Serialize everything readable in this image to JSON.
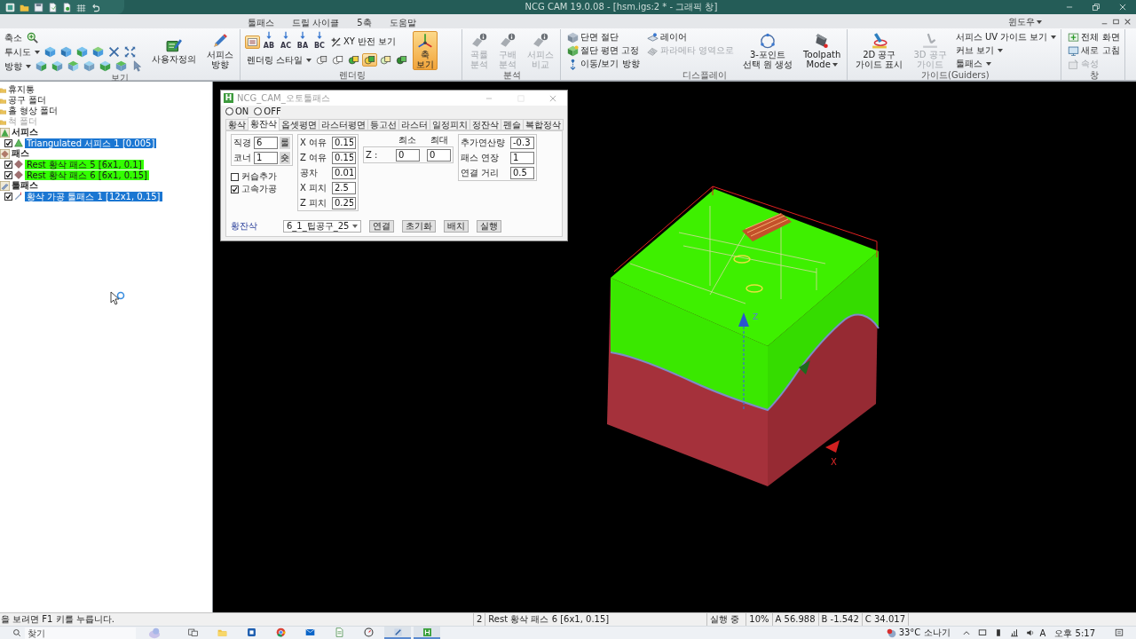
{
  "window": {
    "title": "NCG CAM 19.0.08 - [hsm.igs:2 * - 그래픽 창]"
  },
  "ribbon": {
    "tabs": [
      {
        "label": "툴패스",
        "selected": false
      },
      {
        "label": "드릴 사이클",
        "selected": false
      },
      {
        "label": "5축",
        "selected": false
      },
      {
        "label": "도움말",
        "selected": false
      }
    ],
    "window_menu": "윈도우",
    "groups": [
      {
        "title": "보기",
        "columns": [
          {
            "kind": "stack",
            "rows": [
              [
                {
                  "kind": "text",
                  "label": "축소",
                  "menu": false,
                  "disabled": false
                },
                {
                  "kind": "tool",
                  "on": false
                }
              ],
              [
                {
                  "kind": "text",
                  "label": "투시도",
                  "menu": true,
                  "disabled": false
                },
                {
                  "kind": "tool",
                  "on": false
                },
                {
                  "kind": "tool",
                  "on": false
                },
                {
                  "kind": "tool",
                  "on": false
                },
                {
                  "kind": "tool",
                  "on": false
                },
                {
                  "kind": "tool",
                  "on": false
                },
                {
                  "kind": "tool",
                  "on": false
                }
              ],
              [
                {
                  "kind": "text",
                  "label": "방향",
                  "menu": true,
                  "disabled": false
                },
                {
                  "kind": "tool",
                  "on": false
                },
                {
                  "kind": "tool",
                  "on": false
                },
                {
                  "kind": "tool",
                  "on": false
                },
                {
                  "kind": "tool",
                  "on": false
                },
                {
                  "kind": "tool",
                  "on": false
                },
                {
                  "kind": "tool",
                  "on": false
                },
                {
                  "kind": "tool",
                  "on": false
                }
              ]
            ]
          },
          {
            "kind": "large",
            "label": "사용자정의",
            "menu": false,
            "disabled": false,
            "on": false
          },
          {
            "kind": "large",
            "label": "서피스\n방향",
            "menu": false,
            "disabled": false,
            "on": false
          }
        ]
      },
      {
        "title": "렌더링",
        "columns": [
          {
            "kind": "stack",
            "rows": [
              [
                {
                  "kind": "tool",
                  "on": true
                },
                {
                  "kind": "caption",
                  "label": "AB"
                },
                {
                  "kind": "caption",
                  "label": "AC"
                },
                {
                  "kind": "caption",
                  "label": "BA"
                },
                {
                  "kind": "caption",
                  "label": "BC"
                },
                {
                  "kind": "text",
                  "label": "XY 반전 보기",
                  "menu": false,
                  "disabled": false
                }
              ],
              [
                {
                  "kind": "text",
                  "label": "렌더링 스타일",
                  "menu": true,
                  "disabled": false
                },
                {
                  "kind": "tool",
                  "on": false
                },
                {
                  "kind": "tool",
                  "on": false
                },
                {
                  "kind": "tool",
                  "on": false
                },
                {
                  "kind": "tool",
                  "on": true
                },
                {
                  "kind": "tool",
                  "on": false
                },
                {
                  "kind": "tool",
                  "on": false
                }
              ]
            ]
          },
          {
            "kind": "large",
            "label": "축\n보기",
            "menu": false,
            "disabled": false,
            "on": true
          }
        ]
      },
      {
        "title": "분석",
        "columns": [
          {
            "kind": "large",
            "label": "곡률\n분석",
            "menu": false,
            "disabled": true,
            "on": false
          },
          {
            "kind": "large",
            "label": "구배\n분석",
            "menu": false,
            "disabled": true,
            "on": false
          },
          {
            "kind": "large",
            "label": "서피스\n비교",
            "menu": false,
            "disabled": true,
            "on": false
          }
        ]
      },
      {
        "title": "디스플레이",
        "columns": [
          {
            "kind": "stack",
            "rows": [
              [
                {
                  "kind": "text",
                  "label": "단면 절단",
                  "menu": false,
                  "disabled": false
                }
              ],
              [
                {
                  "kind": "text",
                  "label": "절단 평면 고정",
                  "menu": false,
                  "disabled": false
                }
              ],
              [
                {
                  "kind": "text",
                  "label": "이동/보기 방향",
                  "menu": false,
                  "disabled": false
                }
              ]
            ]
          },
          {
            "kind": "stack",
            "rows": [
              [
                {
                  "kind": "text",
                  "label": "레이어",
                  "menu": false,
                  "disabled": false
                }
              ],
              [
                {
                  "kind": "text",
                  "label": "파라메타 영역으로",
                  "menu": false,
                  "disabled": true
                }
              ]
            ]
          },
          {
            "kind": "large",
            "label": "3-포인트\n선택 원 생성",
            "menu": false,
            "disabled": false,
            "on": false
          },
          {
            "kind": "large",
            "label": "Toolpath\nMode",
            "menu": true,
            "disabled": false,
            "on": false
          }
        ]
      },
      {
        "title": "가이드(Guiders)",
        "columns": [
          {
            "kind": "large",
            "label": "2D 공구\n가이드 표시",
            "menu": false,
            "disabled": false,
            "on": false
          },
          {
            "kind": "large",
            "label": "3D 공구\n가이드",
            "menu": false,
            "disabled": true,
            "on": false
          },
          {
            "kind": "stack",
            "rows": [
              [
                {
                  "kind": "text",
                  "label": "서피스 UV 가이드 보기",
                  "menu": true,
                  "disabled": false
                }
              ],
              [
                {
                  "kind": "text",
                  "label": "커브 보기",
                  "menu": true,
                  "disabled": false
                }
              ],
              [
                {
                  "kind": "text",
                  "label": "툴패스",
                  "menu": true,
                  "disabled": false
                }
              ]
            ]
          }
        ]
      },
      {
        "title": "창",
        "columns": [
          {
            "kind": "stack",
            "rows": [
              [
                {
                  "kind": "text",
                  "label": "전체 화면",
                  "menu": false,
                  "disabled": false
                }
              ],
              [
                {
                  "kind": "text",
                  "label": "새로 고침",
                  "menu": false,
                  "disabled": false
                }
              ],
              [
                {
                  "kind": "text",
                  "label": "속성",
                  "menu": false,
                  "disabled": true
                }
              ]
            ]
          }
        ]
      }
    ]
  },
  "tree": [
    {
      "kind": "folder",
      "label": "휴지통",
      "disabled": false
    },
    {
      "kind": "folder",
      "label": "공구 폴더",
      "disabled": false
    },
    {
      "kind": "folder",
      "label": "홀 형상 폴더",
      "disabled": false
    },
    {
      "kind": "folder",
      "label": "척 폴더",
      "disabled": true
    },
    {
      "kind": "surface",
      "label": "서피스",
      "disabled": false,
      "children": [
        {
          "label": "Triangulated 서피스 1 [0.005]",
          "checked": true,
          "selected": true
        }
      ]
    },
    {
      "kind": "pass",
      "label": "패스",
      "disabled": false,
      "children": [
        {
          "label": "Rest 황삭 패스 5 [6x1, 0.1]",
          "checked": true,
          "selected": false,
          "color": "#33ff00"
        },
        {
          "label": "Rest 황삭 패스 6 [6x1, 0.15]",
          "checked": true,
          "selected": false,
          "color": "#33ff00"
        }
      ]
    },
    {
      "kind": "toolpath",
      "label": "툴패스",
      "disabled": false,
      "children": [
        {
          "label": "황삭 가공 툴패스 1 [12x1, 0.15]",
          "checked": true,
          "selected": true
        }
      ]
    }
  ],
  "dialog": {
    "app_icon": "H",
    "title": "NCG_CAM_오토툴패스",
    "modes": [
      {
        "label": "ON",
        "selected": false
      },
      {
        "label": "OFF",
        "selected": false
      }
    ],
    "tabs": [
      {
        "label": "황삭",
        "selected": false
      },
      {
        "label": "황잔삭",
        "selected": true
      },
      {
        "label": "옵셋평면",
        "selected": false
      },
      {
        "label": "라스터평면",
        "selected": false
      },
      {
        "label": "등고선",
        "selected": false
      },
      {
        "label": "라스터",
        "selected": false
      },
      {
        "label": "일정피치",
        "selected": false
      },
      {
        "label": "정잔삭",
        "selected": false
      },
      {
        "label": "펜슬",
        "selected": false
      },
      {
        "label": "복합정삭",
        "selected": false
      }
    ],
    "tool_fields": [
      {
        "label": "직경",
        "value": "6",
        "button": "룰"
      },
      {
        "label": "코너",
        "value": "1",
        "button": "숏"
      }
    ],
    "options": [
      {
        "label": "커습추가",
        "checked": false
      },
      {
        "label": "고속가공",
        "checked": true
      }
    ],
    "allowances": [
      {
        "label": "X 여유",
        "value": "0.15"
      },
      {
        "label": "Z 여유",
        "value": "0.15"
      },
      {
        "label": "공차",
        "value": "0.01"
      },
      {
        "label": "X 피치",
        "value": "2.5"
      },
      {
        "label": "Z 피치",
        "value": "0.25"
      }
    ],
    "z_range": {
      "min_label": "최소",
      "max_label": "최대",
      "label": "Z :",
      "min": "0",
      "max": "0"
    },
    "extras": [
      {
        "label": "추가연산량",
        "value": "-0.3"
      },
      {
        "label": "패스 연장",
        "value": "1"
      },
      {
        "label": "연결 거리",
        "value": "0.5"
      }
    ],
    "operation_label": "황잔삭",
    "tool_select": "6_1_팁공구_25",
    "buttons": [
      "연결",
      "초기화",
      "배치",
      "실행"
    ]
  },
  "viewport": {
    "z_axis_label": "Z",
    "x_axis_label": "X"
  },
  "status_bar": {
    "help": "을 보려면 F1 키를 누릅니다.",
    "panes": [
      "2",
      "Rest 황삭 패스 6 [6x1, 0.15]",
      "실행 중",
      "10%",
      "A 56.988",
      "B -1.542",
      "C 34.017"
    ]
  },
  "taskbar": {
    "search": {
      "placeholder": "찾기"
    },
    "apps": [
      {
        "active": false
      },
      {
        "active": false
      },
      {
        "active": false
      },
      {
        "active": false
      },
      {
        "active": false
      },
      {
        "active": false
      },
      {
        "active": false
      },
      {
        "active": true
      },
      {
        "active": true
      }
    ],
    "weather": "33°C 소나기",
    "input_indicator": "A",
    "clock": "오후 5:17"
  }
}
